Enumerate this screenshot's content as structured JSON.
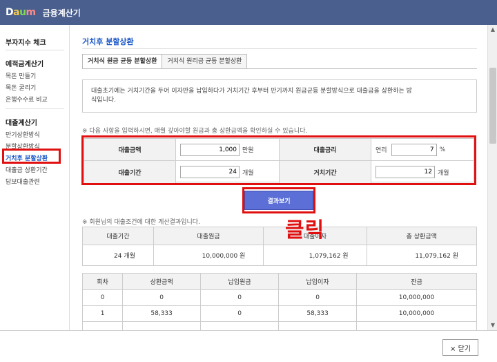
{
  "app": {
    "logo_letters": [
      "D",
      "a",
      "u",
      "m"
    ],
    "logo_colors": [
      "#ffffff",
      "#f7c948",
      "#7ed957",
      "#ff8a8a"
    ],
    "title": "금융계산기"
  },
  "sidebar": {
    "top_item": "부자지수 체크",
    "sections": [
      {
        "heading": "예적금계산기",
        "items": [
          "목돈 만들기",
          "목돈 굴리기",
          "은행수수료 비교"
        ]
      },
      {
        "heading": "대출계산기",
        "items": [
          "만기상환방식",
          "분할상환방식",
          "거치후 분할상환",
          "대출금 상환기간",
          "담보대출관련"
        ]
      }
    ],
    "active_item": "거치후 분할상환"
  },
  "main": {
    "page_title": "거치후 분할상환",
    "tabs": [
      {
        "label": "거치식 원금 균등 분할상환",
        "active": true
      },
      {
        "label": "거치식 원리금 균등 분할상환",
        "active": false
      }
    ],
    "description_line1": "대출초기에는 거치기간을 두어 이자만을 납입하다가 거치기간 후부터 만기까지 원금균등 분할방식으로 대출금을 상환하는 방",
    "description_line2": "식입니다.",
    "input_note": "※ 다음 사항을 입력하시면, 매월 갚아야할 원금과 총 상환금액을 확인하실 수 있습니다.",
    "form": {
      "loan_amount_label": "대출금액",
      "loan_amount_value": "1,000",
      "loan_amount_unit": "만원",
      "interest_label": "대출금리",
      "interest_prefix": "연리",
      "interest_value": "7",
      "interest_unit": "%",
      "period_label": "대출기간",
      "period_value": "24",
      "period_unit": "개월",
      "grace_label": "거치기간",
      "grace_value": "12",
      "grace_unit": "개월"
    },
    "result_button": "결과보기",
    "click_annotation": "클릭",
    "result_note": "※ 회원님의 대출조건에 대한 계산결과입니다.",
    "summary": {
      "headers": [
        "대출기간",
        "대출원금",
        "대출이자",
        "총 상환금액"
      ],
      "values": [
        "24 개월",
        "10,000,000 원",
        "1,079,162 원",
        "11,079,162 원"
      ]
    },
    "schedule": {
      "headers": [
        "회차",
        "상환금액",
        "납입원금",
        "납입이자",
        "잔금"
      ],
      "rows": [
        [
          "0",
          "0",
          "0",
          "0",
          "10,000,000"
        ],
        [
          "1",
          "58,333",
          "0",
          "58,333",
          "10,000,000"
        ]
      ]
    }
  },
  "footer": {
    "close_label": "× 닫기"
  },
  "scrollbar": {
    "up_glyph": "▲",
    "down_glyph": "▼"
  },
  "colors": {
    "titlebar": "#4a5f8e",
    "accent_blue": "#1a56c7",
    "annotation_red": "#e01010",
    "button_blue": "#5b6fd6"
  }
}
